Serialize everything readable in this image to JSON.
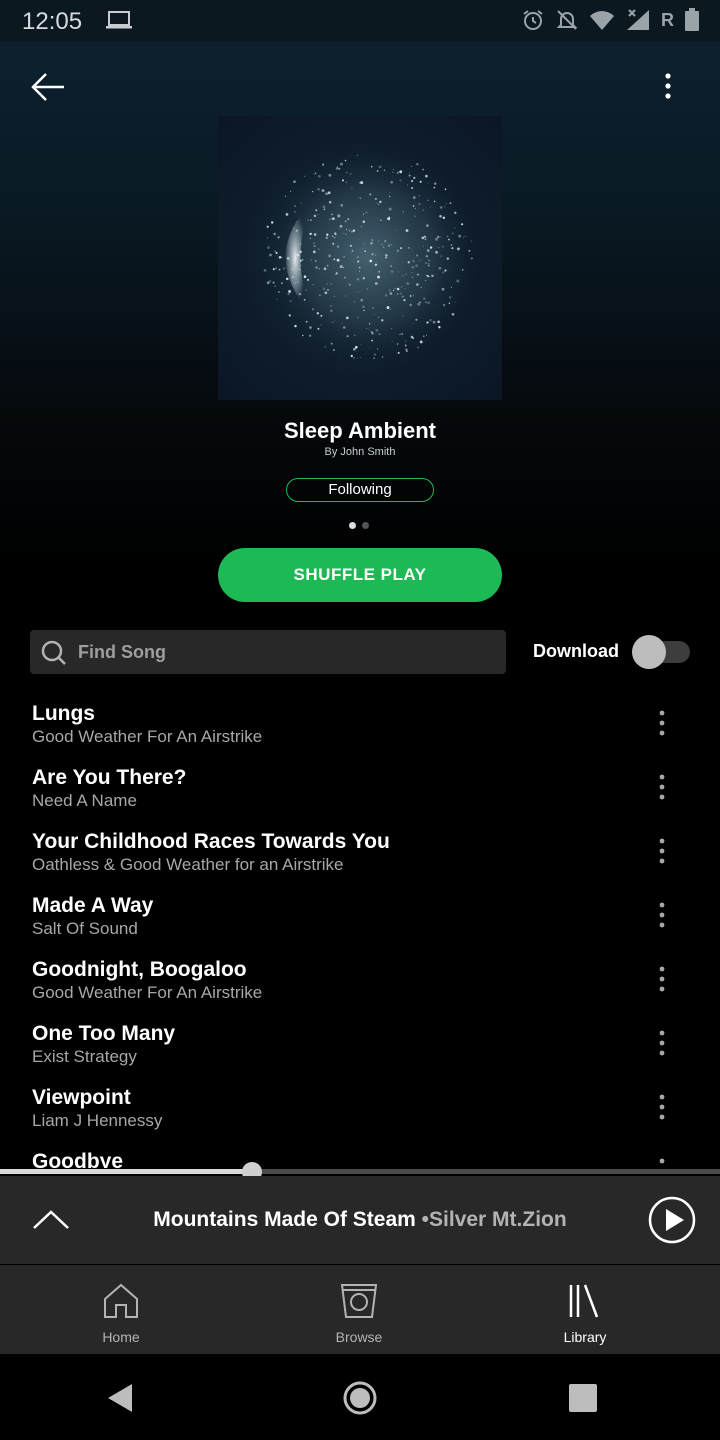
{
  "status_bar": {
    "time": "12:05",
    "icons": [
      "laptop-icon",
      "alarm-icon",
      "notifications-off-icon",
      "wifi-icon",
      "signal-icon",
      "battery-icon"
    ],
    "roaming_indicator": "R"
  },
  "header": {
    "back_icon": "arrow-left-icon",
    "more_icon": "more-vertical-icon"
  },
  "playlist": {
    "title": "Sleep Ambient",
    "byline": "By John Smith",
    "follow_label": "Following",
    "page_dots": 2,
    "active_dot": 0
  },
  "actions": {
    "shuffle_label": "SHUFFLE PLAY",
    "search_placeholder": "Find Song",
    "download_label": "Download",
    "download_enabled": false
  },
  "tracks": [
    {
      "title": "Lungs",
      "artist": "Good Weather For An Airstrike"
    },
    {
      "title": "Are You There?",
      "artist": "Need A Name"
    },
    {
      "title": "Your Childhood Races Towards You",
      "artist": "Oathless & Good Weather for an Airstrike"
    },
    {
      "title": "Made A Way",
      "artist": "Salt Of Sound"
    },
    {
      "title": "Goodnight, Boogaloo",
      "artist": "Good Weather For An Airstrike"
    },
    {
      "title": "One Too Many",
      "artist": "Exist Strategy"
    },
    {
      "title": "Viewpoint",
      "artist": "Liam J Hennessy"
    },
    {
      "title": "Goodbye",
      "artist": ""
    }
  ],
  "player": {
    "title": "Mountains Made Of Steam",
    "separator": "•",
    "artist": "Silver Mt.Zion",
    "progress_fraction": 0.35
  },
  "bottom_nav": [
    {
      "label": "Home",
      "icon": "home-icon",
      "active": false
    },
    {
      "label": "Browse",
      "icon": "browse-icon",
      "active": false
    },
    {
      "label": "Library",
      "icon": "library-icon",
      "active": true
    }
  ],
  "system_nav": [
    "back-triangle-icon",
    "home-circle-icon",
    "recents-square-icon"
  ],
  "colors": {
    "accent": "#1db954",
    "player_bg": "#282828",
    "secondary_text": "#a7a7a7"
  }
}
